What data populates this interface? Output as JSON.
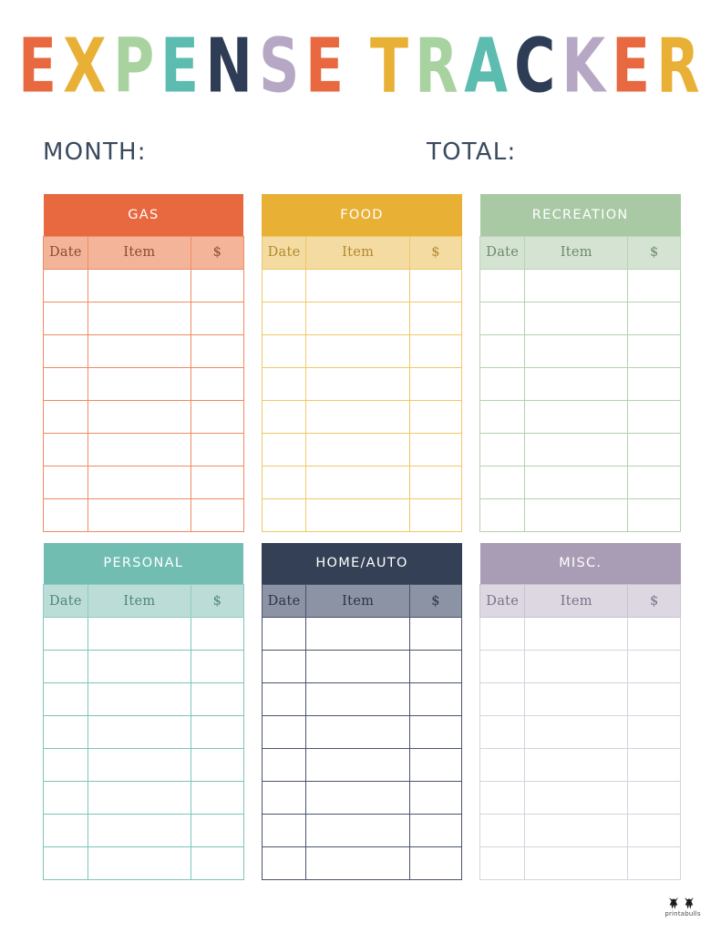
{
  "document": {
    "title_words": [
      {
        "text": "E",
        "color": "#e8683f"
      },
      {
        "text": "X",
        "color": "#e8b136"
      },
      {
        "text": "P",
        "color": "#a8d3a0"
      },
      {
        "text": "E",
        "color": "#5cbcb0"
      },
      {
        "text": "N",
        "color": "#2e3c55"
      },
      {
        "text": "S",
        "color": "#b6a8c4"
      },
      {
        "text": "E",
        "color": "#e8683f"
      },
      {
        "text": " ",
        "color": ""
      },
      {
        "text": "T",
        "color": "#e8b136"
      },
      {
        "text": "R",
        "color": "#a8d3a0"
      },
      {
        "text": "A",
        "color": "#5cbcb0"
      },
      {
        "text": "C",
        "color": "#2e3c55"
      },
      {
        "text": "K",
        "color": "#b6a8c4"
      },
      {
        "text": "E",
        "color": "#e8683f"
      },
      {
        "text": "R",
        "color": "#e8b136"
      }
    ],
    "title_plain": "EXPENSE TRACKER"
  },
  "fields": {
    "month_label": "MONTH:",
    "total_label": "TOTAL:"
  },
  "columns": {
    "date": "Date",
    "item": "Item",
    "amount": "$"
  },
  "row_count": 8,
  "categories": [
    {
      "id": "gas",
      "name": "GAS",
      "header_color": "#e8683f",
      "subheader_color": "#f3b49a",
      "border_color": "#f08a61",
      "rows": [
        {
          "date": "",
          "item": "",
          "amount": ""
        },
        {
          "date": "",
          "item": "",
          "amount": ""
        },
        {
          "date": "",
          "item": "",
          "amount": ""
        },
        {
          "date": "",
          "item": "",
          "amount": ""
        },
        {
          "date": "",
          "item": "",
          "amount": ""
        },
        {
          "date": "",
          "item": "",
          "amount": ""
        },
        {
          "date": "",
          "item": "",
          "amount": ""
        },
        {
          "date": "",
          "item": "",
          "amount": ""
        }
      ]
    },
    {
      "id": "food",
      "name": "FOOD",
      "header_color": "#e8b136",
      "subheader_color": "#f4dba2",
      "border_color": "#f0c964",
      "rows": [
        {
          "date": "",
          "item": "",
          "amount": ""
        },
        {
          "date": "",
          "item": "",
          "amount": ""
        },
        {
          "date": "",
          "item": "",
          "amount": ""
        },
        {
          "date": "",
          "item": "",
          "amount": ""
        },
        {
          "date": "",
          "item": "",
          "amount": ""
        },
        {
          "date": "",
          "item": "",
          "amount": ""
        },
        {
          "date": "",
          "item": "",
          "amount": ""
        },
        {
          "date": "",
          "item": "",
          "amount": ""
        }
      ]
    },
    {
      "id": "recreation",
      "name": "RECREATION",
      "header_color": "#a8c9a4",
      "subheader_color": "#d5e4d2",
      "border_color": "#b4d1b0",
      "rows": [
        {
          "date": "",
          "item": "",
          "amount": ""
        },
        {
          "date": "",
          "item": "",
          "amount": ""
        },
        {
          "date": "",
          "item": "",
          "amount": ""
        },
        {
          "date": "",
          "item": "",
          "amount": ""
        },
        {
          "date": "",
          "item": "",
          "amount": ""
        },
        {
          "date": "",
          "item": "",
          "amount": ""
        },
        {
          "date": "",
          "item": "",
          "amount": ""
        },
        {
          "date": "",
          "item": "",
          "amount": ""
        }
      ]
    },
    {
      "id": "personal",
      "name": "PERSONAL",
      "header_color": "#71bdb2",
      "subheader_color": "#bcdcd8",
      "border_color": "#7cc4ba",
      "rows": [
        {
          "date": "",
          "item": "",
          "amount": ""
        },
        {
          "date": "",
          "item": "",
          "amount": ""
        },
        {
          "date": "",
          "item": "",
          "amount": ""
        },
        {
          "date": "",
          "item": "",
          "amount": ""
        },
        {
          "date": "",
          "item": "",
          "amount": ""
        },
        {
          "date": "",
          "item": "",
          "amount": ""
        },
        {
          "date": "",
          "item": "",
          "amount": ""
        },
        {
          "date": "",
          "item": "",
          "amount": ""
        }
      ]
    },
    {
      "id": "home-auto",
      "name": "HOME/AUTO",
      "header_color": "#344056",
      "subheader_color": "#8b93a5",
      "border_color": "#49536b",
      "rows": [
        {
          "date": "",
          "item": "",
          "amount": ""
        },
        {
          "date": "",
          "item": "",
          "amount": ""
        },
        {
          "date": "",
          "item": "",
          "amount": ""
        },
        {
          "date": "",
          "item": "",
          "amount": ""
        },
        {
          "date": "",
          "item": "",
          "amount": ""
        },
        {
          "date": "",
          "item": "",
          "amount": ""
        },
        {
          "date": "",
          "item": "",
          "amount": ""
        },
        {
          "date": "",
          "item": "",
          "amount": ""
        }
      ]
    },
    {
      "id": "misc",
      "name": "MISC.",
      "header_color": "#a99cb5",
      "subheader_color": "#ddd7e1",
      "border_color": "#d9d1df",
      "rows": [
        {
          "date": "",
          "item": "",
          "amount": ""
        },
        {
          "date": "",
          "item": "",
          "amount": ""
        },
        {
          "date": "",
          "item": "",
          "amount": ""
        },
        {
          "date": "",
          "item": "",
          "amount": ""
        },
        {
          "date": "",
          "item": "",
          "amount": ""
        },
        {
          "date": "",
          "item": "",
          "amount": ""
        },
        {
          "date": "",
          "item": "",
          "amount": ""
        },
        {
          "date": "",
          "item": "",
          "amount": ""
        }
      ]
    }
  ],
  "footer": {
    "brand": "printabulls",
    "logo_icon": "two-bull-heads-icon"
  }
}
